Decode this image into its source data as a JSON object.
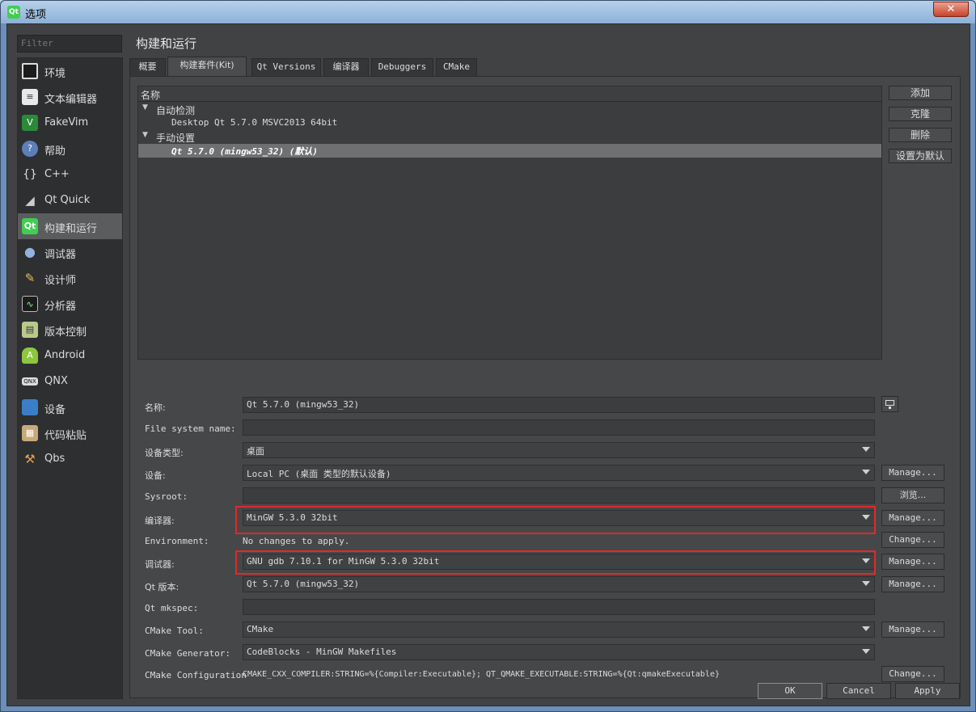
{
  "window": {
    "title": "选项",
    "app_icon": "Qt",
    "close_glyph": "✕"
  },
  "filter_placeholder": "Filter",
  "sidebar": {
    "items": [
      {
        "label": "环境",
        "icon": "monitor-icon",
        "glyph": ""
      },
      {
        "label": "文本编辑器",
        "icon": "text-editor-icon",
        "glyph": "≡"
      },
      {
        "label": "FakeVim",
        "icon": "fakevim-icon",
        "glyph": "V"
      },
      {
        "label": "帮助",
        "icon": "help-icon",
        "glyph": "?"
      },
      {
        "label": "C++",
        "icon": "braces-icon",
        "glyph": "{}"
      },
      {
        "label": "Qt Quick",
        "icon": "qt-quick-icon",
        "glyph": "◢"
      },
      {
        "label": "构建和运行",
        "icon": "build-run-icon",
        "glyph": "Qt"
      },
      {
        "label": "调试器",
        "icon": "debugger-icon",
        "glyph": "●"
      },
      {
        "label": "设计师",
        "icon": "designer-icon",
        "glyph": "✎"
      },
      {
        "label": "分析器",
        "icon": "analyzer-icon",
        "glyph": "∿"
      },
      {
        "label": "版本控制",
        "icon": "version-control-icon",
        "glyph": "▤"
      },
      {
        "label": "Android",
        "icon": "android-icon",
        "glyph": "A"
      },
      {
        "label": "QNX",
        "icon": "qnx-icon",
        "glyph": "QNX"
      },
      {
        "label": "设备",
        "icon": "devices-icon",
        "glyph": "■"
      },
      {
        "label": "代码粘贴",
        "icon": "code-paste-icon",
        "glyph": "▦"
      },
      {
        "label": "Qbs",
        "icon": "qbs-icon",
        "glyph": "⚒"
      }
    ],
    "active_index": 6
  },
  "page_title": "构建和运行",
  "tabs": [
    {
      "label": "概要"
    },
    {
      "label": "构建套件(Kit)"
    },
    {
      "label": "Qt Versions"
    },
    {
      "label": "编译器"
    },
    {
      "label": "Debuggers"
    },
    {
      "label": "CMake"
    }
  ],
  "active_tab": 1,
  "kit_tree": {
    "header": "名称",
    "groups": [
      {
        "label": "自动检测",
        "items": [
          "Desktop Qt 5.7.0 MSVC2013 64bit"
        ]
      },
      {
        "label": "手动设置",
        "items": [
          "Qt 5.7.0 (mingw53_32) (默认)"
        ]
      }
    ],
    "caret_glyph": "▼"
  },
  "kit_buttons": {
    "add": "添加",
    "clone": "克隆",
    "remove": "删除",
    "make_default": "设置为默认"
  },
  "form": {
    "name": {
      "label": "名称:",
      "value": "Qt 5.7.0 (mingw53_32)"
    },
    "filesystem_name": {
      "label": "File system name:",
      "value": ""
    },
    "device_type": {
      "label": "设备类型:",
      "value": "桌面"
    },
    "device": {
      "label": "设备:",
      "value": "Local PC (桌面 类型的默认设备)",
      "button": "Manage..."
    },
    "sysroot": {
      "label": "Sysroot:",
      "value": "",
      "button": "浏览..."
    },
    "compiler": {
      "label": "编译器:",
      "value": "MinGW 5.3.0 32bit",
      "button": "Manage..."
    },
    "environment": {
      "label": "Environment:",
      "value": "No changes to apply.",
      "button": "Change..."
    },
    "debugger": {
      "label": "调试器:",
      "value": "GNU gdb 7.10.1 for MinGW 5.3.0 32bit",
      "button": "Manage..."
    },
    "qt_version": {
      "label": "Qt 版本:",
      "value": "Qt 5.7.0 (mingw53_32)",
      "button": "Manage..."
    },
    "qt_mkspec": {
      "label": "Qt mkspec:",
      "value": ""
    },
    "cmake_tool": {
      "label": "CMake Tool:",
      "value": "CMake",
      "button": "Manage..."
    },
    "cmake_generator": {
      "label": "CMake Generator:",
      "value": "CodeBlocks - MinGW Makefiles"
    },
    "cmake_config": {
      "label": "CMake Configuration",
      "value": "CMAKE_CXX_COMPILER:STRING=%{Compiler:Executable}; QT_QMAKE_EXECUTABLE:STRING=%{Qt:qmakeExecutable}",
      "button": "Change..."
    }
  },
  "dialog_buttons": {
    "ok": "OK",
    "cancel": "Cancel",
    "apply": "Apply"
  },
  "colors": {
    "highlight": "#e02a2a",
    "selection": "#6e7072",
    "background": "#404244"
  }
}
